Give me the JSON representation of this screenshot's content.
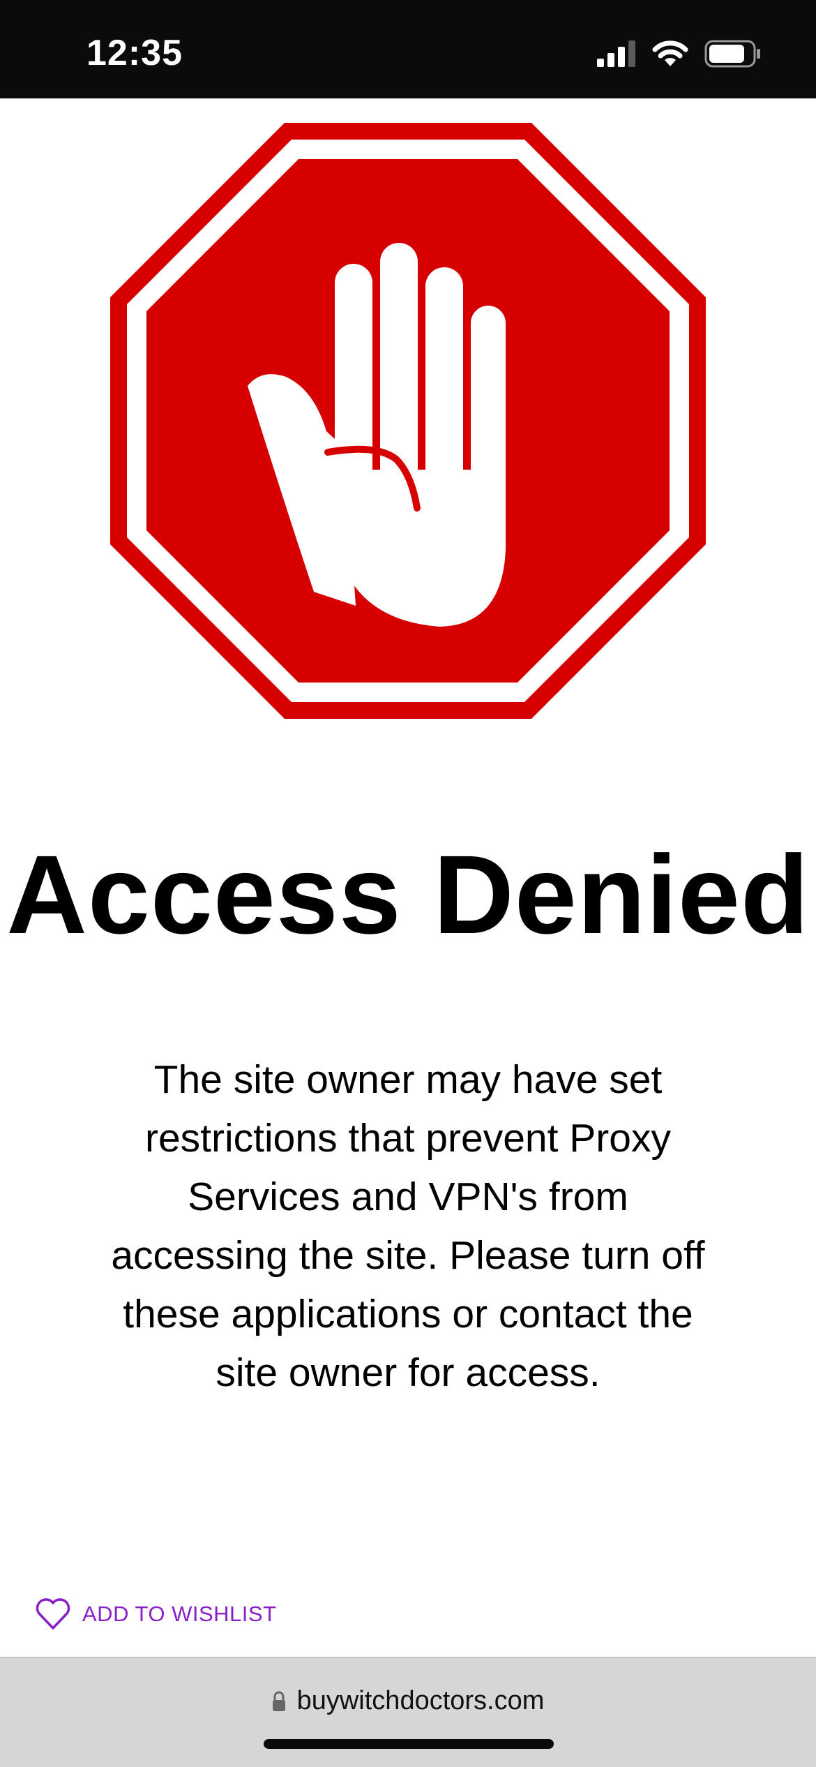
{
  "status_bar": {
    "time": "12:35",
    "icons": [
      "cellular-signal-icon",
      "wifi-icon",
      "battery-icon"
    ]
  },
  "page": {
    "sign_icon": "stop-hand-icon",
    "title": "Access Denied",
    "message_lines": [
      "The site owner may have set",
      "restrictions that prevent Proxy",
      "Services and VPN's from",
      "accessing the site. Please turn off",
      "these applications or contact the",
      "site owner for access."
    ]
  },
  "wishlist": {
    "icon": "heart-icon",
    "label": "ADD TO WISHLIST"
  },
  "browser": {
    "url": "buywitchdoctors.com",
    "lock_icon": "lock-icon"
  },
  "colors": {
    "sign_red": "#d70000",
    "wishlist_purple": "#8a1fc8",
    "status_bar_bg": "#0b0b0c",
    "url_bar_bg": "#d6d6d6"
  }
}
